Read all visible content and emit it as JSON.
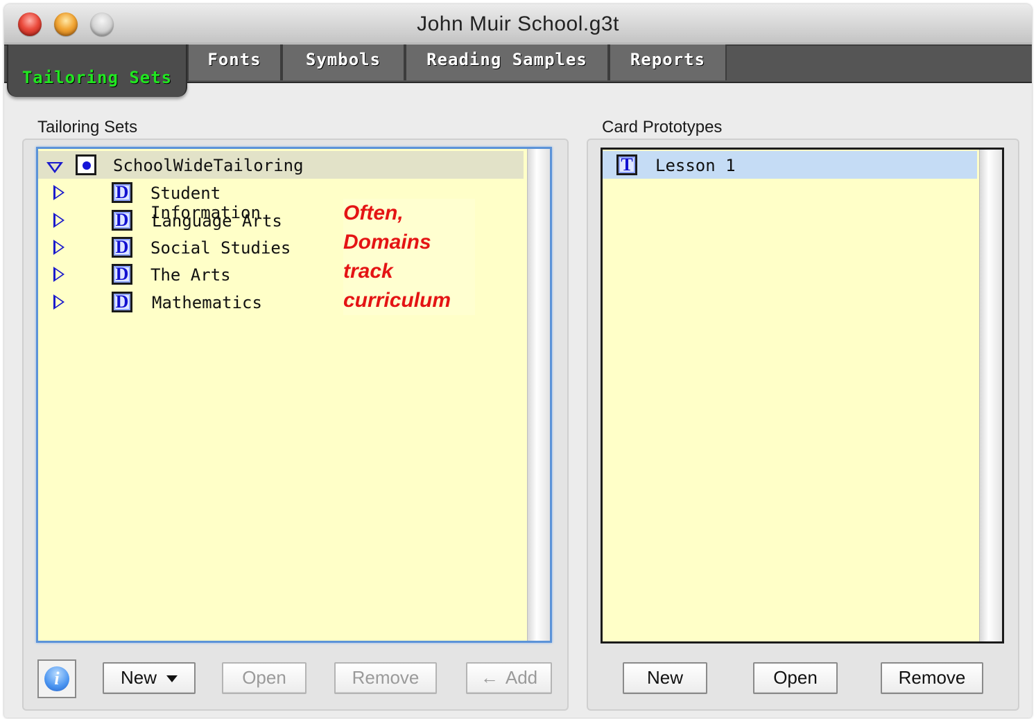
{
  "window": {
    "title": "John Muir School.g3t"
  },
  "tabs": [
    {
      "label": "Tailoring Sets",
      "active": true
    },
    {
      "label": "Fonts",
      "active": false
    },
    {
      "label": "Symbols",
      "active": false
    },
    {
      "label": "Reading Samples",
      "active": false
    },
    {
      "label": "Reports",
      "active": false
    }
  ],
  "tailoring_sets": {
    "group_label": "Tailoring Sets",
    "root": {
      "label": "SchoolWideTailoring",
      "expanded": true
    },
    "items": [
      {
        "label": "Student Information",
        "icon_letter": "D"
      },
      {
        "label": "Language Arts",
        "icon_letter": "D"
      },
      {
        "label": "Social Studies",
        "icon_letter": "D"
      },
      {
        "label": "The Arts",
        "icon_letter": "D"
      },
      {
        "label": "Mathematics",
        "icon_letter": "D"
      }
    ],
    "annotation": [
      "Often,",
      "Domains",
      "track",
      "curriculum"
    ],
    "buttons": {
      "info": "i",
      "new": "New",
      "open": "Open",
      "remove": "Remove",
      "add": "Add",
      "add_arrow": "←"
    }
  },
  "card_prototypes": {
    "group_label": "Card Prototypes",
    "items": [
      {
        "label": "Lesson 1",
        "icon_letter": "T",
        "selected": true
      }
    ],
    "buttons": {
      "new": "New",
      "open": "Open",
      "remove": "Remove"
    }
  },
  "colors": {
    "list_background": "#ffffc8",
    "active_tab_text": "#21e621",
    "annotation_text": "#e41414",
    "icon_letter": "#1212d0"
  }
}
